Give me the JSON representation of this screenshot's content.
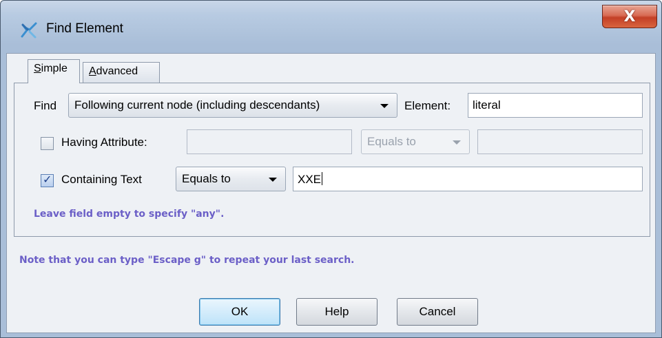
{
  "window": {
    "title": "Find Element",
    "close_label": "X"
  },
  "tabs": [
    {
      "label_underlined": "S",
      "label_rest": "imple",
      "active": true
    },
    {
      "label_underlined": "A",
      "label_rest": "dvanced",
      "active": false
    }
  ],
  "find_row": {
    "find_label": "Find",
    "scope_value": "Following current node (including descendants)",
    "element_label": "Element:",
    "element_value": "literal"
  },
  "attribute_row": {
    "checked": false,
    "label": "Having Attribute:",
    "name_value": "",
    "operator_value": "Equals to",
    "attr_value": ""
  },
  "text_row": {
    "checked": true,
    "label": "Containing Text",
    "operator_value": "Equals to",
    "text_value": "XXE"
  },
  "hints": {
    "empty_field": "Leave field empty to specify \"any\".",
    "escape_g": "Note that you can type \"Escape g\" to repeat your last search."
  },
  "buttons": {
    "ok": "OK",
    "help": "Help",
    "cancel": "Cancel"
  },
  "icons": {
    "title_icon": "xxe-find-icon",
    "close_icon": "close-icon"
  }
}
